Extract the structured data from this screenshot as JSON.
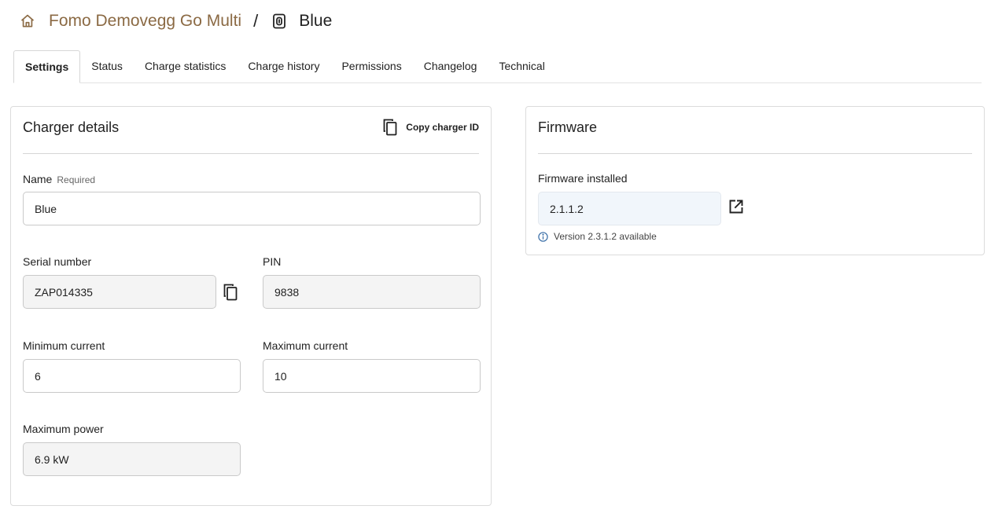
{
  "breadcrumb": {
    "home_icon": "home-icon",
    "site_name": "Fomo Demovegg Go Multi",
    "separator": "/",
    "charger_icon": "ev-charger-icon",
    "charger_name": "Blue"
  },
  "tabs": [
    {
      "label": "Settings",
      "active": true
    },
    {
      "label": "Status",
      "active": false
    },
    {
      "label": "Charge statistics",
      "active": false
    },
    {
      "label": "Charge history",
      "active": false
    },
    {
      "label": "Permissions",
      "active": false
    },
    {
      "label": "Changelog",
      "active": false
    },
    {
      "label": "Technical",
      "active": false
    }
  ],
  "charger_details": {
    "title": "Charger details",
    "copy_id_label": "Copy charger ID",
    "name": {
      "label": "Name",
      "required_hint": "Required",
      "value": "Blue"
    },
    "serial": {
      "label": "Serial number",
      "value": "ZAP014335"
    },
    "pin": {
      "label": "PIN",
      "value": "9838"
    },
    "min_current": {
      "label": "Minimum current",
      "value": "6"
    },
    "max_current": {
      "label": "Maximum current",
      "value": "10"
    },
    "max_power": {
      "label": "Maximum power",
      "value": "6.9 kW"
    }
  },
  "firmware": {
    "title": "Firmware",
    "installed_label": "Firmware installed",
    "installed_value": "2.1.1.2",
    "update_notice": "Version 2.3.1.2 available"
  },
  "colors": {
    "accent": "#8b6a44",
    "info": "#3b6fa8"
  }
}
